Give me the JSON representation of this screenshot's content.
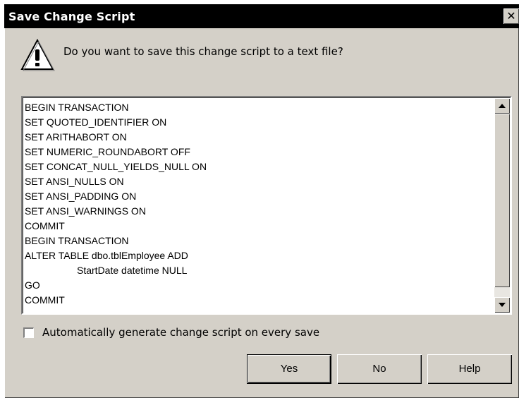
{
  "dialog": {
    "title": "Save Change Script",
    "close_glyph": "✕",
    "icon": "warning-icon",
    "question": "Do you want to save this change script to a text file?"
  },
  "script": {
    "lines": [
      "BEGIN TRANSACTION",
      "SET QUOTED_IDENTIFIER ON",
      "SET ARITHABORT ON",
      "SET NUMERIC_ROUNDABORT OFF",
      "SET CONCAT_NULL_YIELDS_NULL ON",
      "SET ANSI_NULLS ON",
      "SET ANSI_PADDING ON",
      "SET ANSI_WARNINGS ON",
      "COMMIT",
      "BEGIN TRANSACTION",
      "ALTER TABLE dbo.tblEmployee ADD",
      "StartDate datetime NULL",
      "GO",
      "COMMIT"
    ]
  },
  "options": {
    "auto_generate_label": "Automatically generate change script on every save",
    "auto_generate_checked": false
  },
  "buttons": {
    "yes": "Yes",
    "no": "No",
    "help": "Help"
  },
  "colors": {
    "titlebar": "#000000",
    "dialog_face": "#d4d0c8"
  }
}
